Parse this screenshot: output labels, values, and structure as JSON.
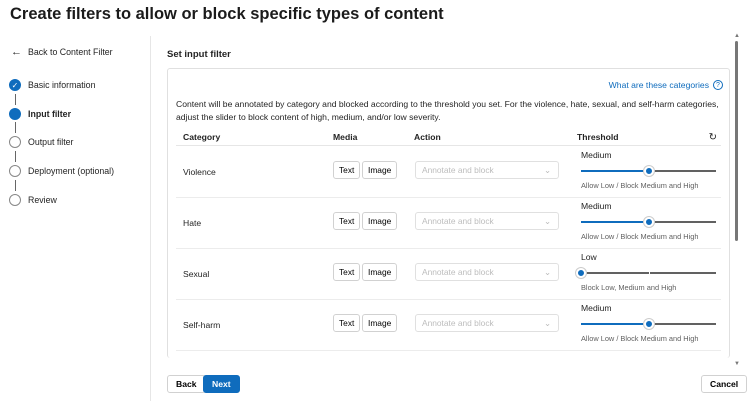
{
  "title": "Create filters to allow or block specific types of content",
  "sidebar": {
    "back": "Back to Content Filter",
    "steps": [
      {
        "label": "Basic information",
        "state": "done"
      },
      {
        "label": "Input filter",
        "state": "current"
      },
      {
        "label": "Output filter",
        "state": "todo"
      },
      {
        "label": "Deployment (optional)",
        "state": "todo"
      },
      {
        "label": "Review",
        "state": "todo"
      }
    ]
  },
  "main": {
    "heading": "Set input filter",
    "help_link": "What are these categories",
    "description": "Content will be annotated by category and blocked according to the threshold you set. For the violence, hate, sexual, and self-harm categories, adjust the slider to block content of high, medium, and/or low severity.",
    "columns": {
      "category": "Category",
      "media": "Media",
      "action": "Action",
      "threshold": "Threshold"
    },
    "rows": [
      {
        "category": "Violence",
        "text": "Text",
        "image": "Image",
        "action": "Annotate and block",
        "level": "Medium",
        "level_value": 0.5,
        "note": "Allow Low / Block Medium and High"
      },
      {
        "category": "Hate",
        "text": "Text",
        "image": "Image",
        "action": "Annotate and block",
        "level": "Medium",
        "level_value": 0.5,
        "note": "Allow Low / Block Medium and High"
      },
      {
        "category": "Sexual",
        "text": "Text",
        "image": "Image",
        "action": "Annotate and block",
        "level": "Low",
        "level_value": 0,
        "note": "Block Low, Medium and High"
      },
      {
        "category": "Self-harm",
        "text": "Text",
        "image": "Image",
        "action": "Annotate and block",
        "level": "Medium",
        "level_value": 0.5,
        "note": "Allow Low / Block Medium and High"
      }
    ]
  },
  "footer": {
    "back": "Back",
    "next": "Next",
    "cancel": "Cancel"
  },
  "colors": {
    "accent": "#0f6cbd"
  }
}
